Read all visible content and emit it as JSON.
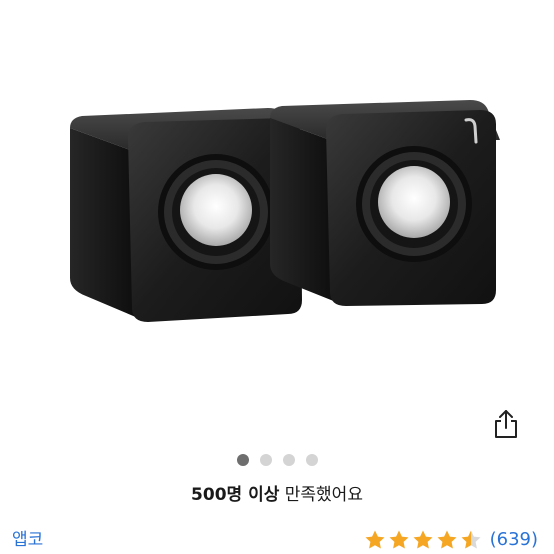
{
  "product": {
    "image_icon": "speaker-pair-photo",
    "rating_fraction": 0.9
  },
  "toolbar": {
    "share_icon": "share-icon"
  },
  "carousel": {
    "page_count": 4,
    "active_index": 0
  },
  "review_summary": {
    "count_text": "500명 이상",
    "satisfied_text": "만족했어요"
  },
  "brand": {
    "name": "앱코"
  },
  "rating": {
    "stars": 4.5,
    "count_label": "(639)",
    "star_color": "#f5a623",
    "empty_star_color": "#d9d9d9"
  },
  "colors": {
    "link": "#2a73d6",
    "dot_active": "#6e6e6e",
    "dot_inactive": "#d4d4d4"
  }
}
